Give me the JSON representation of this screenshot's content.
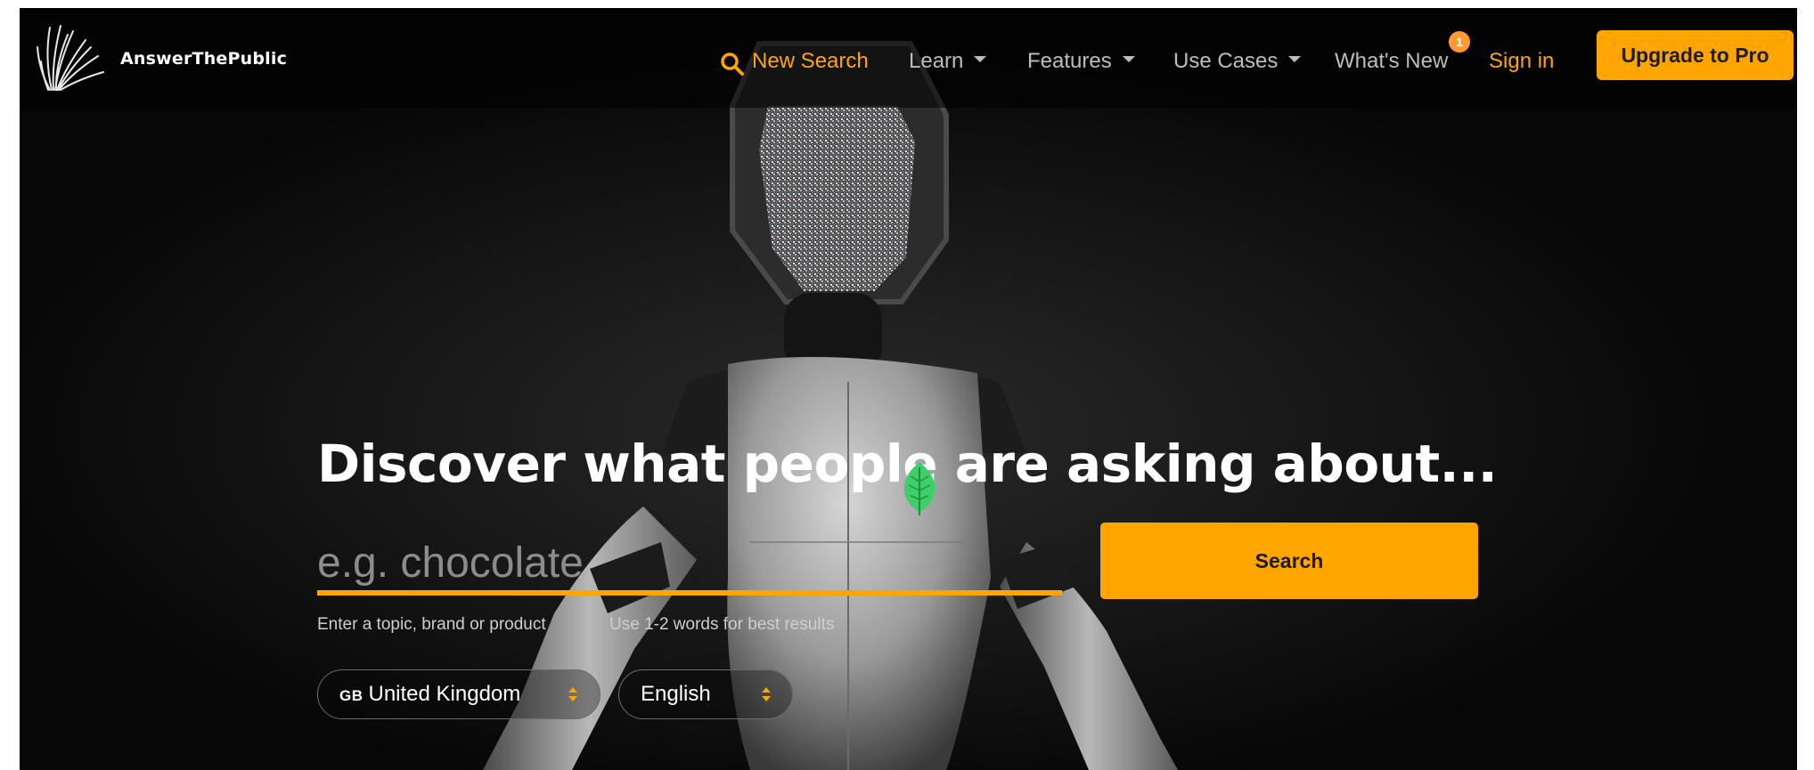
{
  "nav": {
    "brand": "AnswerThePublic",
    "new_search": "New Search",
    "learn": "Learn",
    "features": "Features",
    "use_cases": "Use Cases",
    "whats_new": "What's New",
    "whats_new_badge": "1",
    "sign_in": "Sign in",
    "upgrade": "Upgrade to Pro"
  },
  "hero": {
    "headline": "Discover what people are asking about...",
    "search_placeholder": "e.g. chocolate",
    "search_button": "Search",
    "hint_topic": "Enter a topic, brand or product",
    "hint_words": "Use 1-2 words for best results",
    "country_code": "GB",
    "country": "United Kingdom",
    "language": "English"
  },
  "colors": {
    "accent": "#ffa500",
    "badge": "#ff9933",
    "background": "#070707"
  },
  "icons": [
    "burst-logo-icon",
    "search-icon",
    "chevron-down-icon",
    "leaf-icon",
    "select-updown-icon"
  ]
}
